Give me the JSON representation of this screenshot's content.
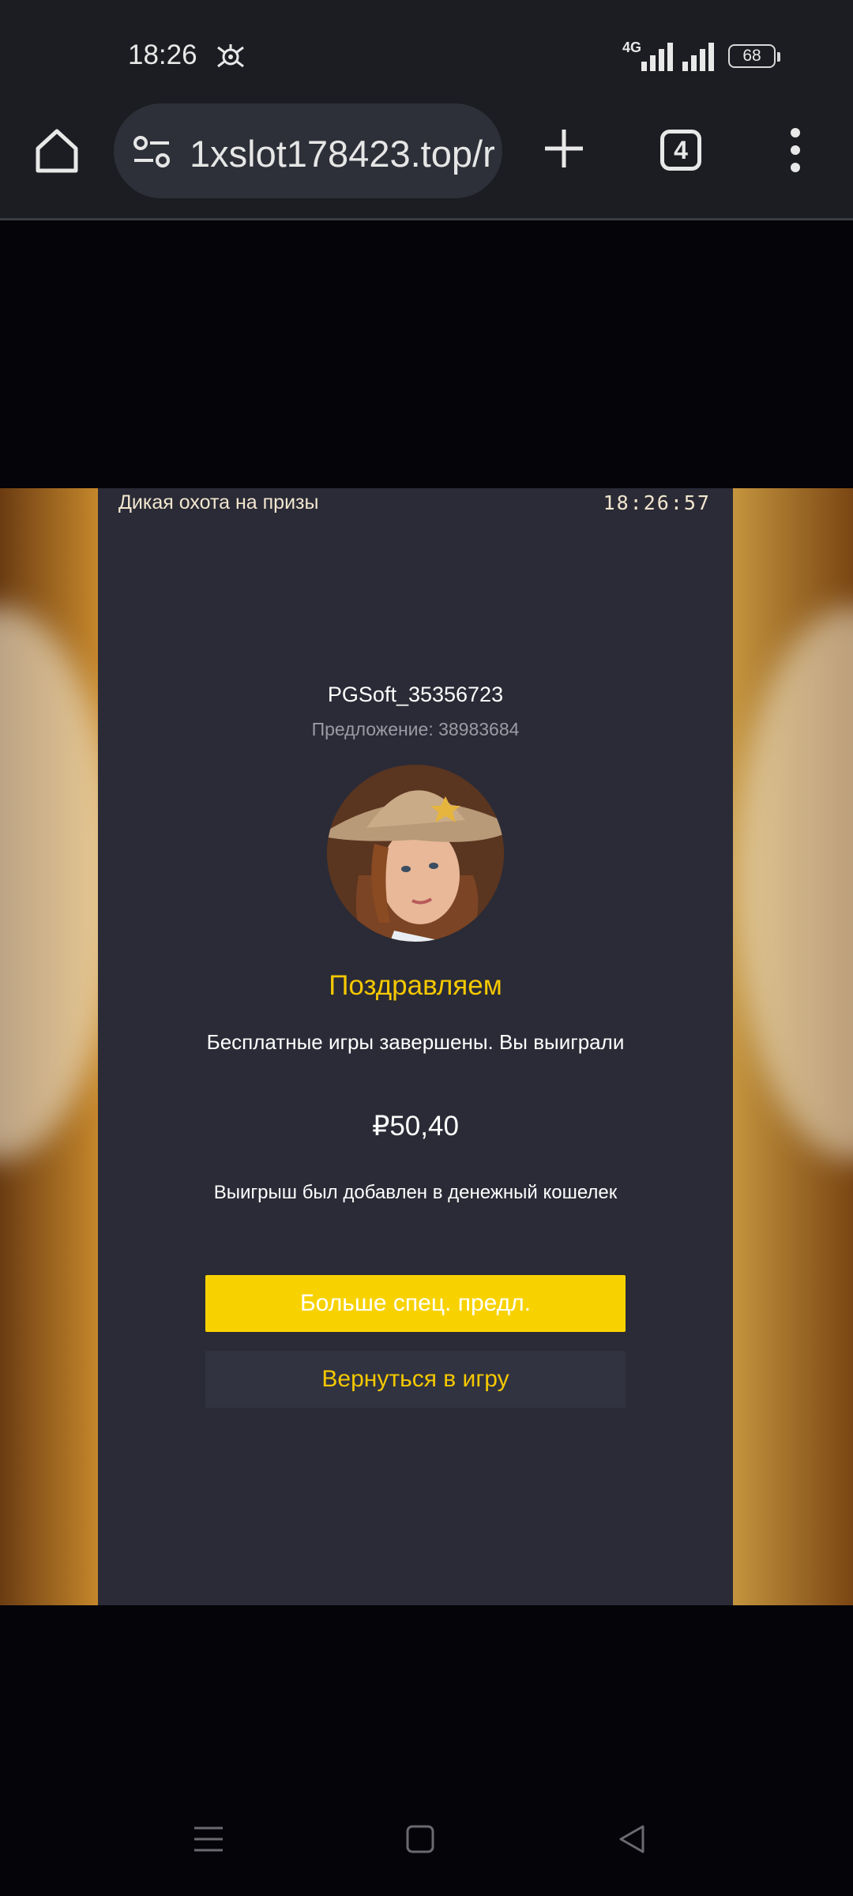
{
  "status_bar": {
    "time": "18:26",
    "network_label": "4G",
    "battery_level": "68"
  },
  "browser": {
    "url": "1xslot178423.top/r",
    "tab_count": "4"
  },
  "dialog": {
    "title": "Дикая охота на призы",
    "clock": "18:26:57",
    "username": "PGSoft_35356723",
    "offer_label": "Предложение: 38983684",
    "congrats": "Поздравляем",
    "description": "Бесплатные игры завершены. Вы выиграли",
    "amount": "₽50,40",
    "wallet_message": "Выигрыш был добавлен в денежный кошелек",
    "primary_button": "Больше спец. предл.",
    "secondary_button": "Вернуться в игру"
  },
  "colors": {
    "accent_yellow": "#f8d200",
    "dialog_bg": "#2a2b36",
    "toolbar_bg": "#1c1d22"
  },
  "icons": {
    "home": "home-icon",
    "site_settings": "tune-icon",
    "new_tab": "plus-icon",
    "menu": "more-vert-icon",
    "nav_recents": "menu-lines-icon",
    "nav_home": "square-icon",
    "nav_back": "triangle-back-icon"
  }
}
